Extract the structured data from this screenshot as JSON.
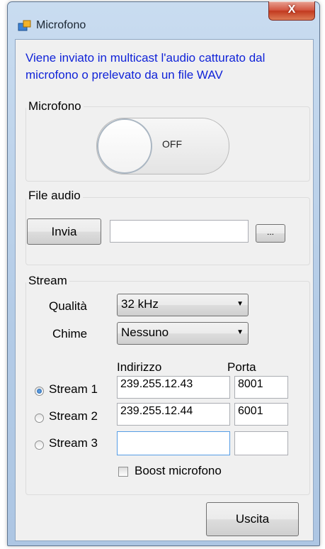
{
  "window": {
    "title": "Microfono",
    "close_glyph": "X",
    "app_icon": "app-window-icon"
  },
  "info": {
    "text": "Viene inviato in multicast l'audio catturato dal microfono o prelevato da un file WAV"
  },
  "microphone": {
    "group_label": "Microfono",
    "toggle_state": "OFF"
  },
  "file_audio": {
    "group_label": "File audio",
    "send_label": "Invia",
    "path_value": "",
    "browse_label": "..."
  },
  "stream": {
    "group_label": "Stream",
    "quality_label": "Qualità",
    "quality_value": "32 kHz",
    "chime_label": "Chime",
    "chime_value": "Nessuno",
    "address_header": "Indirizzo",
    "port_header": "Porta",
    "rows": [
      {
        "label": "Stream 1",
        "address": "239.255.12.43",
        "port": "8001",
        "selected": true
      },
      {
        "label": "Stream 2",
        "address": "239.255.12.44",
        "port": "6001",
        "selected": false
      },
      {
        "label": "Stream 3",
        "address": "",
        "port": "",
        "selected": false
      }
    ],
    "boost_label": "Boost microfono",
    "boost_checked": false
  },
  "exit_label": "Uscita",
  "colors": {
    "info_text": "#1023d8",
    "close_button": "#c2391f",
    "window_border": "#b3cbe6"
  }
}
